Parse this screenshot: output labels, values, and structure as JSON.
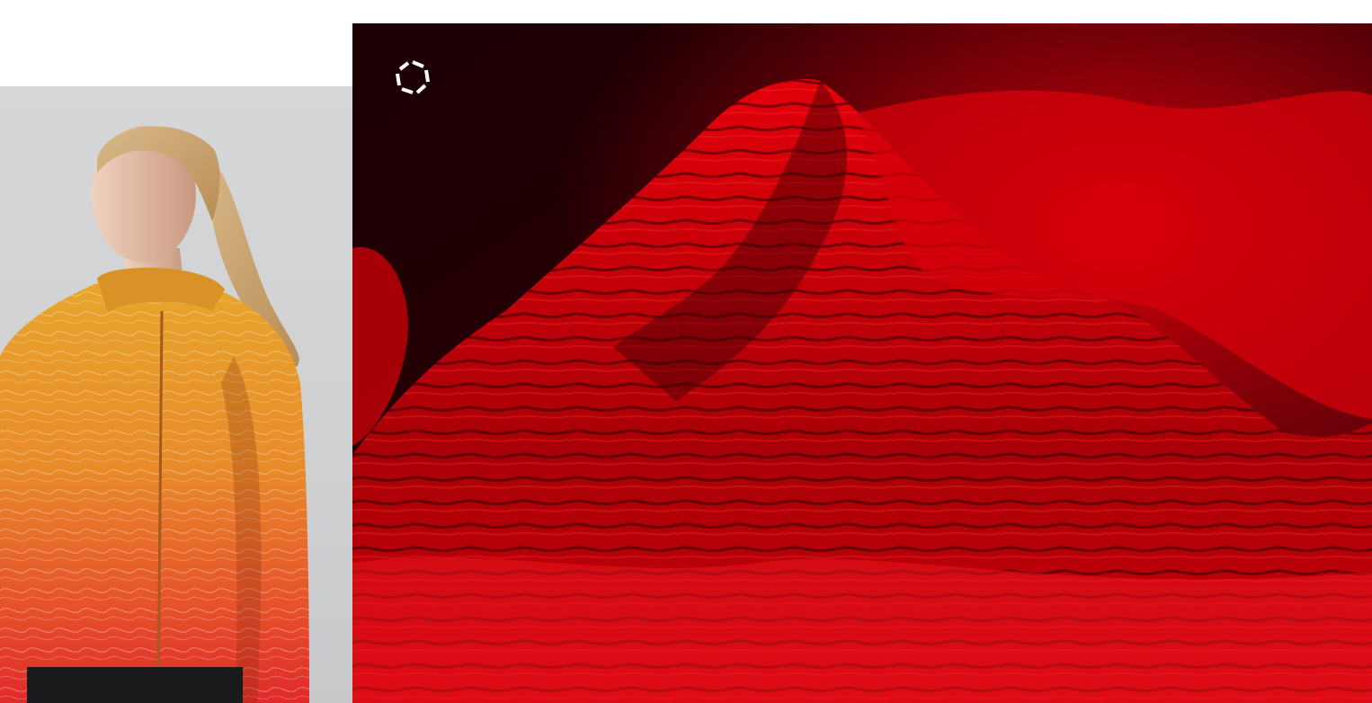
{
  "colors": {
    "jacket_top": "#e8a42a",
    "jacket_bottom": "#e3262a",
    "hero_sky": "#1a0004",
    "hero_red": "#d10008",
    "loader": "#ffffff"
  },
  "icons": {
    "loader": "loading-ring-icon"
  }
}
